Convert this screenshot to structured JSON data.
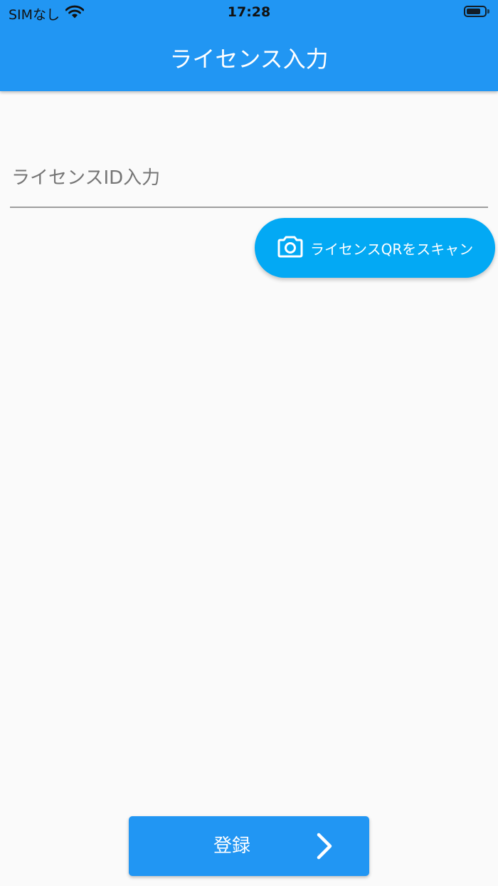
{
  "status_bar": {
    "carrier": "SIMなし",
    "time": "17:28",
    "battery_level": 0.8
  },
  "app_bar": {
    "title": "ライセンス入力",
    "color": "#2196f3"
  },
  "license_input": {
    "value": "",
    "placeholder": "ライセンスID入力"
  },
  "scan_button": {
    "label": "ライセンスQRをスキャン",
    "icon": "camera-icon",
    "color": "#03a9f4"
  },
  "register_button": {
    "label": "登録",
    "icon": "chevron-right-icon",
    "color": "#2196f3"
  }
}
